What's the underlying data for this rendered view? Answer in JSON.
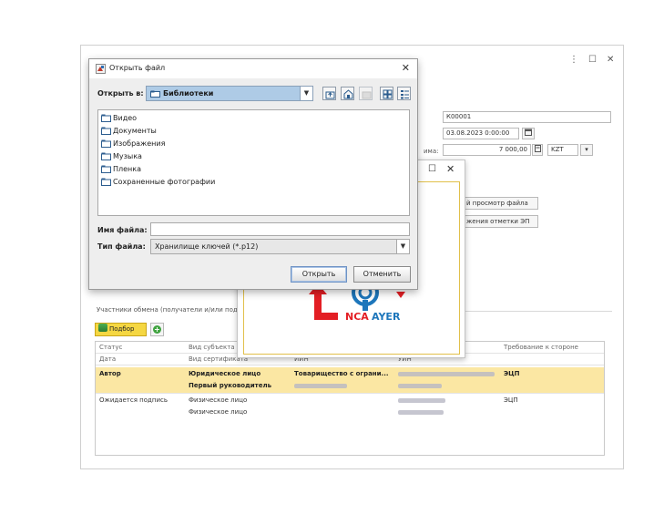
{
  "main_window": {
    "controls": {
      "menu": "⋮",
      "maximize": "☐",
      "close": "✕"
    },
    "fields": {
      "number": "К00001",
      "datetime": "03.08.2023 0:00:00",
      "amount_label_tail": "има:",
      "amount": "7 000,00",
      "currency": "KZT"
    },
    "actions": {
      "preview": "й просмотр файла",
      "stamp": "жения отметки ЭП"
    },
    "participants": {
      "title": "Участники обмена (получатели и/или подп",
      "podbor_label": "Подбор",
      "columns_row1": [
        "Статус",
        "Вид субъекта",
        "",
        "",
        "Требование к стороне"
      ],
      "columns_row2": [
        "Дата",
        "Вид сертификата",
        "ИИН",
        "УИН"
      ],
      "rows": [
        {
          "status": "Автор",
          "subject": "Юридическое лицо",
          "cert_type": "Первый руководитель",
          "name": "Товарищество с ограни...",
          "requirement": "ЭЦП"
        },
        {
          "status": "Ожидается подпись",
          "subject": "Физическое лицо",
          "cert_type": "Физическое лицо",
          "name": "",
          "requirement": "ЭЦП"
        }
      ]
    }
  },
  "nca_window": {
    "minimize": "☐",
    "close": "✕",
    "logo": {
      "word_left": "NCA",
      "word_right": "AYER",
      "color_red": "#e31e24",
      "color_blue": "#1d76bb"
    }
  },
  "file_dialog": {
    "title": "Открыть файл",
    "close": "✕",
    "look_in_label": "Открыть в:",
    "look_in_value": "Библиотеки",
    "items": [
      "Видео",
      "Документы",
      "Изображения",
      "Музыка",
      "Пленка",
      "Сохраненные фотографии"
    ],
    "filename_label": "Имя файла:",
    "filename_value": "",
    "filetype_label": "Тип файла:",
    "filetype_value": "Хранилище ключей (*.p12)",
    "open_button": "Открыть",
    "cancel_button": "Отменить",
    "combo_arrow": "▼"
  }
}
